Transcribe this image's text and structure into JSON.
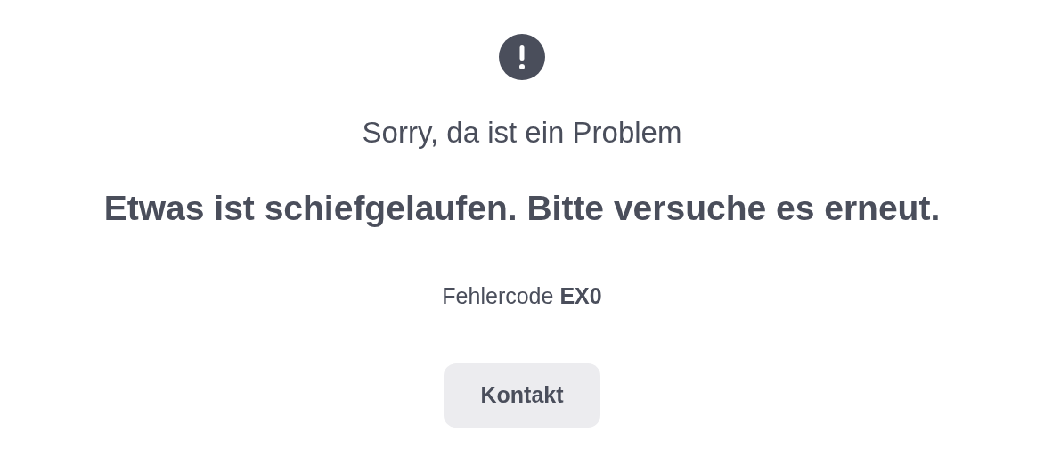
{
  "subtitle": "Sorry, da ist ein Problem",
  "heading": "Etwas ist schiefgelaufen. Bitte versuche es erneut.",
  "error_code": "Fehlercode **EX0**",
  "button": {
    "label": "Kontakt"
  }
}
